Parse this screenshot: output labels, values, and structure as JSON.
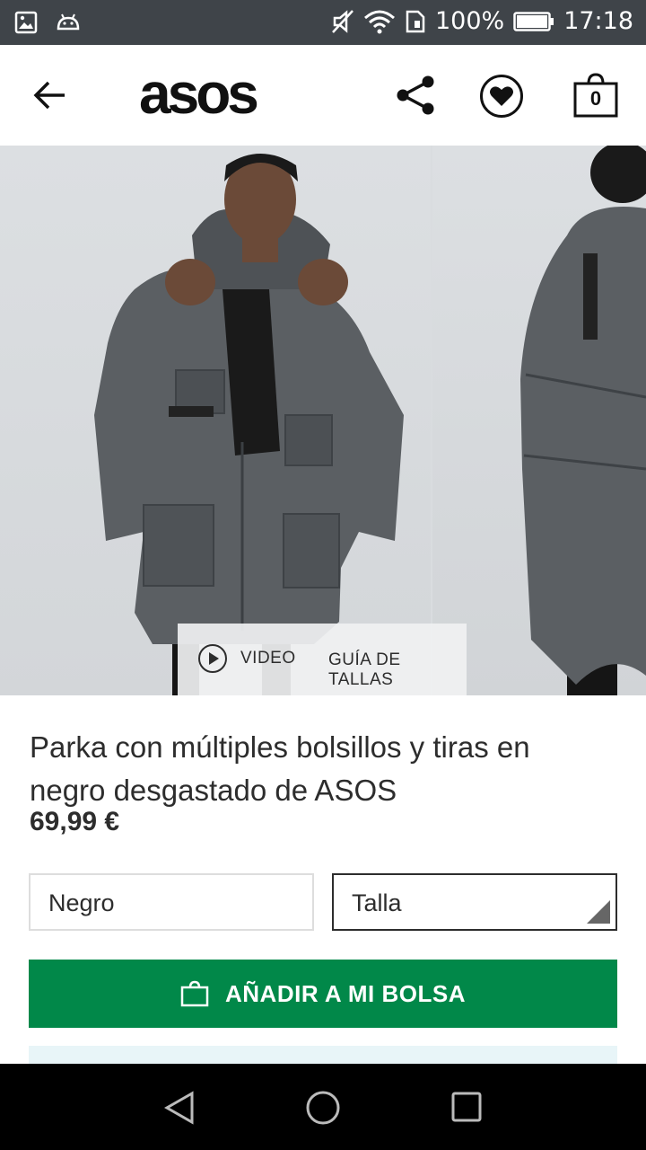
{
  "status_bar": {
    "battery": "100%",
    "time": "17:18",
    "icons": [
      "gallery-icon",
      "android-icon",
      "mute-icon",
      "wifi-icon",
      "sim-icon",
      "battery-icon"
    ]
  },
  "header": {
    "logo": "asos",
    "bag_count": "0",
    "icons": [
      "back-arrow-icon",
      "share-icon",
      "heart-icon",
      "bag-icon"
    ]
  },
  "gallery": {
    "video_label": "VIDEO",
    "size_guide_label": "GUÍA DE TALLAS"
  },
  "product": {
    "title": "Parka con múltiples bolsillos y tiras en negro desgastado de ASOS",
    "price": "69,99 €",
    "color_value": "Negro",
    "size_placeholder": "Talla"
  },
  "actions": {
    "add_to_bag": "AÑADIR A MI BOLSA"
  },
  "colors": {
    "status_bar": "#3f4449",
    "primary_button": "#018849",
    "text": "#2d2d2d",
    "info_strip": "#e8f5f8"
  },
  "nav_bar": {
    "icons": [
      "nav-back-icon",
      "nav-home-icon",
      "nav-recents-icon"
    ]
  }
}
